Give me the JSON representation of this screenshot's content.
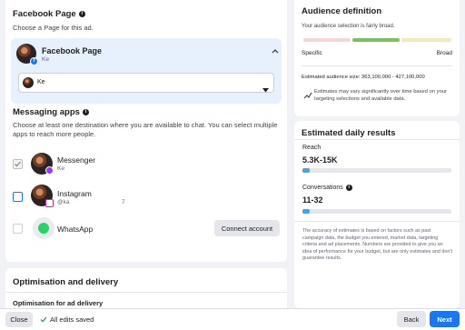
{
  "facebook_page": {
    "title": "Facebook Page",
    "subtitle": "Choose a Page for this ad.",
    "page_name": "Facebook Page",
    "page_handle": "Ke",
    "select_value": "Ke",
    "chevron": "chevron-up-icon"
  },
  "messaging": {
    "title": "Messaging apps",
    "subtitle": "Choose at least one destination where you are available to chat. You can select multiple apps to reach more people.",
    "apps": [
      {
        "name": "Messenger",
        "detail": "Ke",
        "checked": true
      },
      {
        "name": "Instagram",
        "detail": "@ka",
        "detail_suffix": "7",
        "checked": false
      },
      {
        "name": "WhatsApp",
        "detail": "",
        "checked": false,
        "action": "Connect account"
      }
    ]
  },
  "optimisation": {
    "title": "Optimisation and delivery",
    "field_label": "Optimisation for ad delivery"
  },
  "audience": {
    "title": "Audience definition",
    "status": "Your audience selection is fairly broad.",
    "left_label": "Specific",
    "right_label": "Broad",
    "size_text": "Estimated audience size: 363,100,000 - 427,100,000",
    "note": "Estimates may vary significantly over time based on your targeting selections and available data."
  },
  "daily_results": {
    "title": "Estimated daily results",
    "reach_label": "Reach",
    "reach_value": "5.3K-15K",
    "reach_fill": 0.05,
    "conv_label": "Conversations",
    "conv_value": "11-32",
    "conv_fill": 0.05,
    "disclaimer": "The accuracy of estimates is based on factors such as past campaign data, the budget you entered, market data, targeting criteria and ad placements. Numbers are provided to give you an idea of performance for your budget, but are only estimates and don't guarantee results."
  },
  "footer": {
    "close": "Close",
    "saved": "All edits saved",
    "back": "Back",
    "next": "Next"
  },
  "colors": {
    "accent": "#1877f2",
    "saved_green": "#31a24c",
    "audience_green": "#79c15a"
  }
}
